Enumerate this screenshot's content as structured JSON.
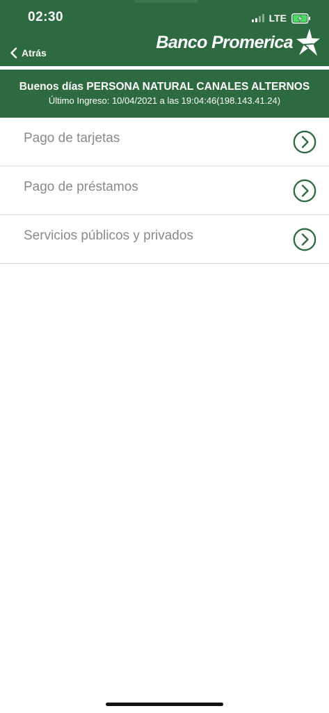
{
  "status_bar": {
    "time": "02:30",
    "network": "LTE",
    "icons": [
      "signal-icon",
      "battery-charging-icon"
    ]
  },
  "nav": {
    "back_label": "Atrás",
    "back_icon": "chevron-left-icon"
  },
  "brand": {
    "name": "Banco Promerica",
    "logo_icon": "star-logo-icon"
  },
  "greeting": {
    "title": "Buenos días PERSONA NATURAL CANALES ALTERNOS",
    "last_login": "Último Ingreso: 10/04/2021 a las 19:04:46(198.143.41.24)"
  },
  "menu": {
    "items": [
      {
        "label": "Pago de tarjetas",
        "icon": "chevron-circle-right-icon"
      },
      {
        "label": "Pago de préstamos",
        "icon": "chevron-circle-right-icon"
      },
      {
        "label": "Servicios públicos y privados",
        "icon": "chevron-circle-right-icon"
      }
    ]
  },
  "colors": {
    "header_green": "#2d6a3f",
    "arrow_green": "#2d6a3f",
    "label_gray": "#8a8a8a",
    "battery_green": "#4cd964"
  }
}
